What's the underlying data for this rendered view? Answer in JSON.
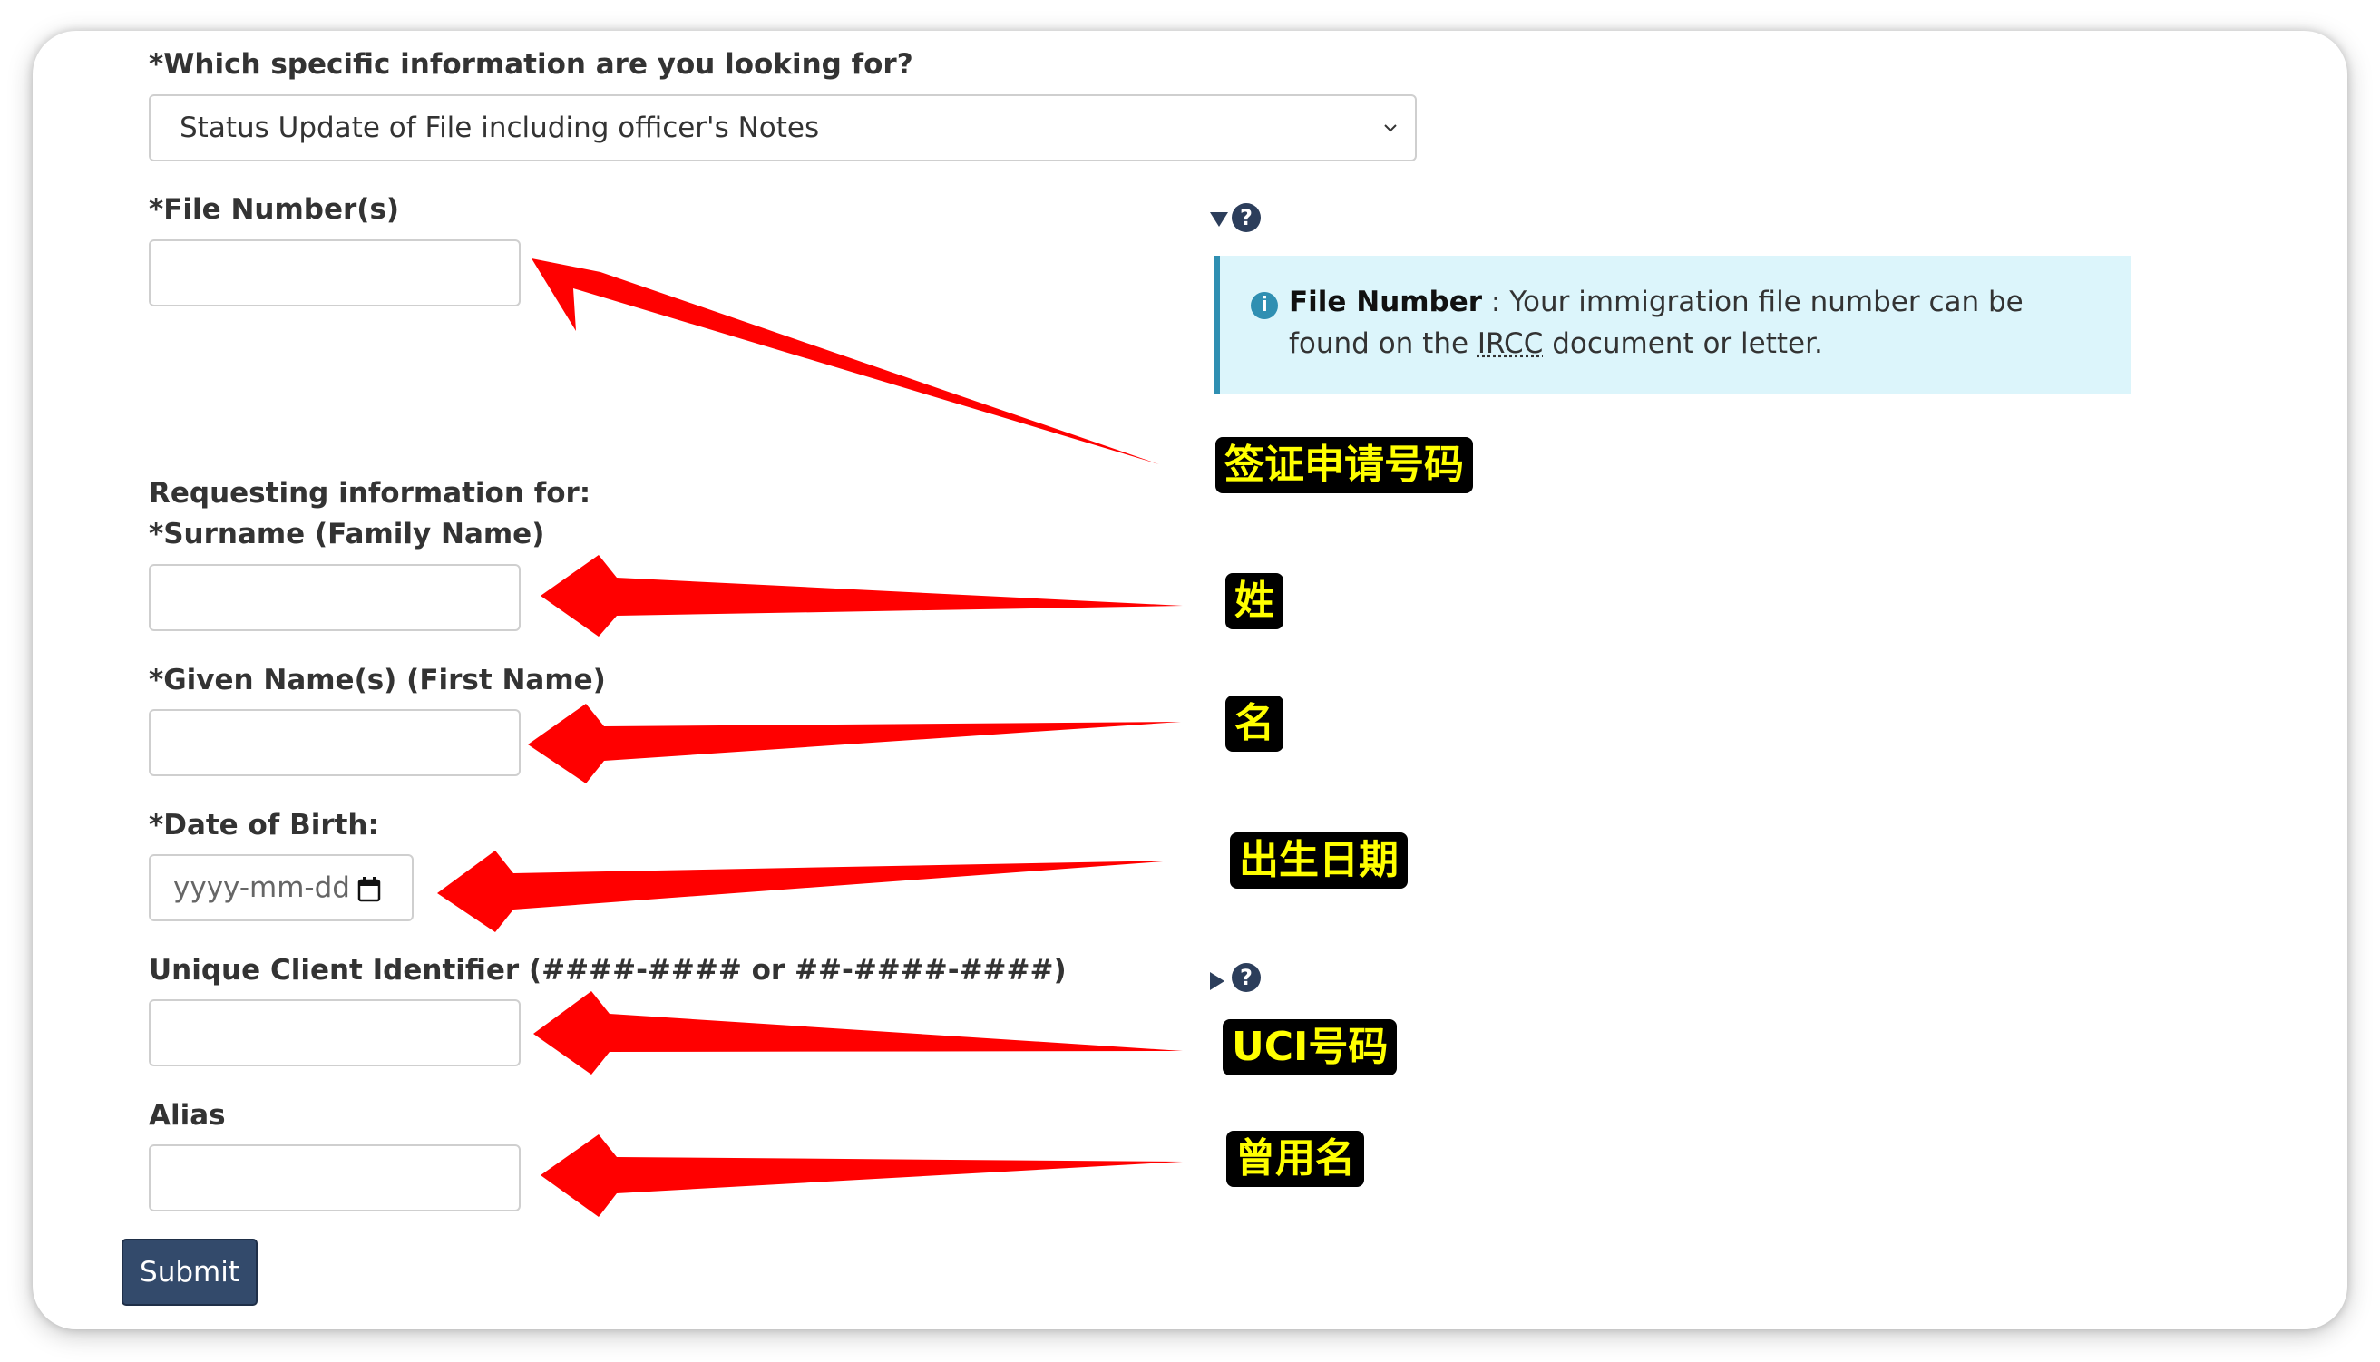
{
  "form": {
    "info_question_label": "*Which specific information are you looking for?",
    "info_select_value": "Status Update of File including officer's Notes",
    "file_number_label": "*File Number(s)",
    "requesting_label": "Requesting information for:",
    "surname_label": "*Surname (Family Name)",
    "given_name_label": "*Given Name(s) (First Name)",
    "dob_label": "*Date of Birth:",
    "dob_placeholder": "yyyy-mm-dd",
    "uci_label": "Unique Client Identifier (####-#### or ##-####-####)",
    "alias_label": "Alias",
    "submit_label": "Submit"
  },
  "help": {
    "file_number_toggle": "?",
    "info_icon": "i",
    "title": "File Number",
    "text_before": " : Your immigration file number can be found on the ",
    "abbr": "IRCC",
    "text_after": " document or letter.",
    "uci_toggle": "?"
  },
  "annotations": {
    "file_number": "签证申请号码",
    "surname": "姓",
    "given_name": "名",
    "dob": "出生日期",
    "uci": "UCI号码",
    "alias": "曾用名"
  },
  "colors": {
    "arrow": "#ff0000",
    "annotation_bg": "#000000",
    "annotation_text": "#ffff00",
    "submit_bg": "#334a6b",
    "info_bg": "#dcf5fb"
  },
  "icons": [
    "chevron-down-icon",
    "calendar-icon",
    "question-circle-icon",
    "info-circle-icon",
    "caret-down-icon",
    "caret-right-icon"
  ]
}
